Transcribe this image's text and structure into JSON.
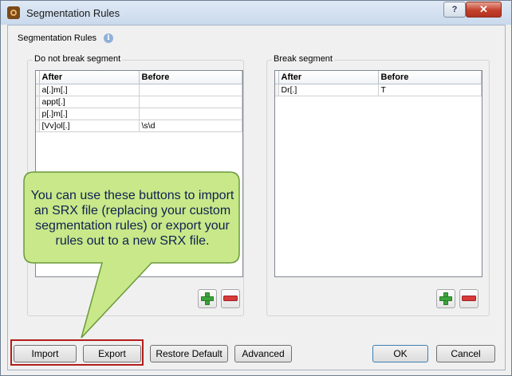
{
  "window": {
    "title": "Segmentation Rules",
    "help_glyph": "?",
    "close_glyph": "✕"
  },
  "main": {
    "section_label": "Segmentation Rules",
    "info_glyph": "i"
  },
  "do_not_break": {
    "label": "Do not break segment",
    "columns": [
      "After",
      "Before"
    ],
    "rows": [
      {
        "after": "a[.]m[.]",
        "before": ""
      },
      {
        "after": "appt[.]",
        "before": ""
      },
      {
        "after": "p[.]m[.]",
        "before": ""
      },
      {
        "after": "[Vv]ol[.]",
        "before": "\\s\\d"
      }
    ]
  },
  "break": {
    "label": "Break segment",
    "columns": [
      "After",
      "Before"
    ],
    "rows": [
      {
        "after": "Dr[.]",
        "before": "T"
      }
    ]
  },
  "buttons": {
    "import": "Import",
    "export": "Export",
    "restore_default": "Restore Default",
    "advanced": "Advanced",
    "ok": "OK",
    "cancel": "Cancel"
  },
  "callout": {
    "text": "You can use these buttons to import an SRX file (replacing your custom segmentation rules) or export your rules out to a new SRX file.",
    "fill_color": "#c8e88a",
    "border_color": "#6a9a3a"
  },
  "colors": {
    "highlight": "#b31c1c",
    "add_green": "#3aa33a",
    "remove_red": "#d83a3a"
  },
  "icons": [
    "app-icon",
    "info-icon",
    "plus-icon",
    "minus-icon"
  ]
}
